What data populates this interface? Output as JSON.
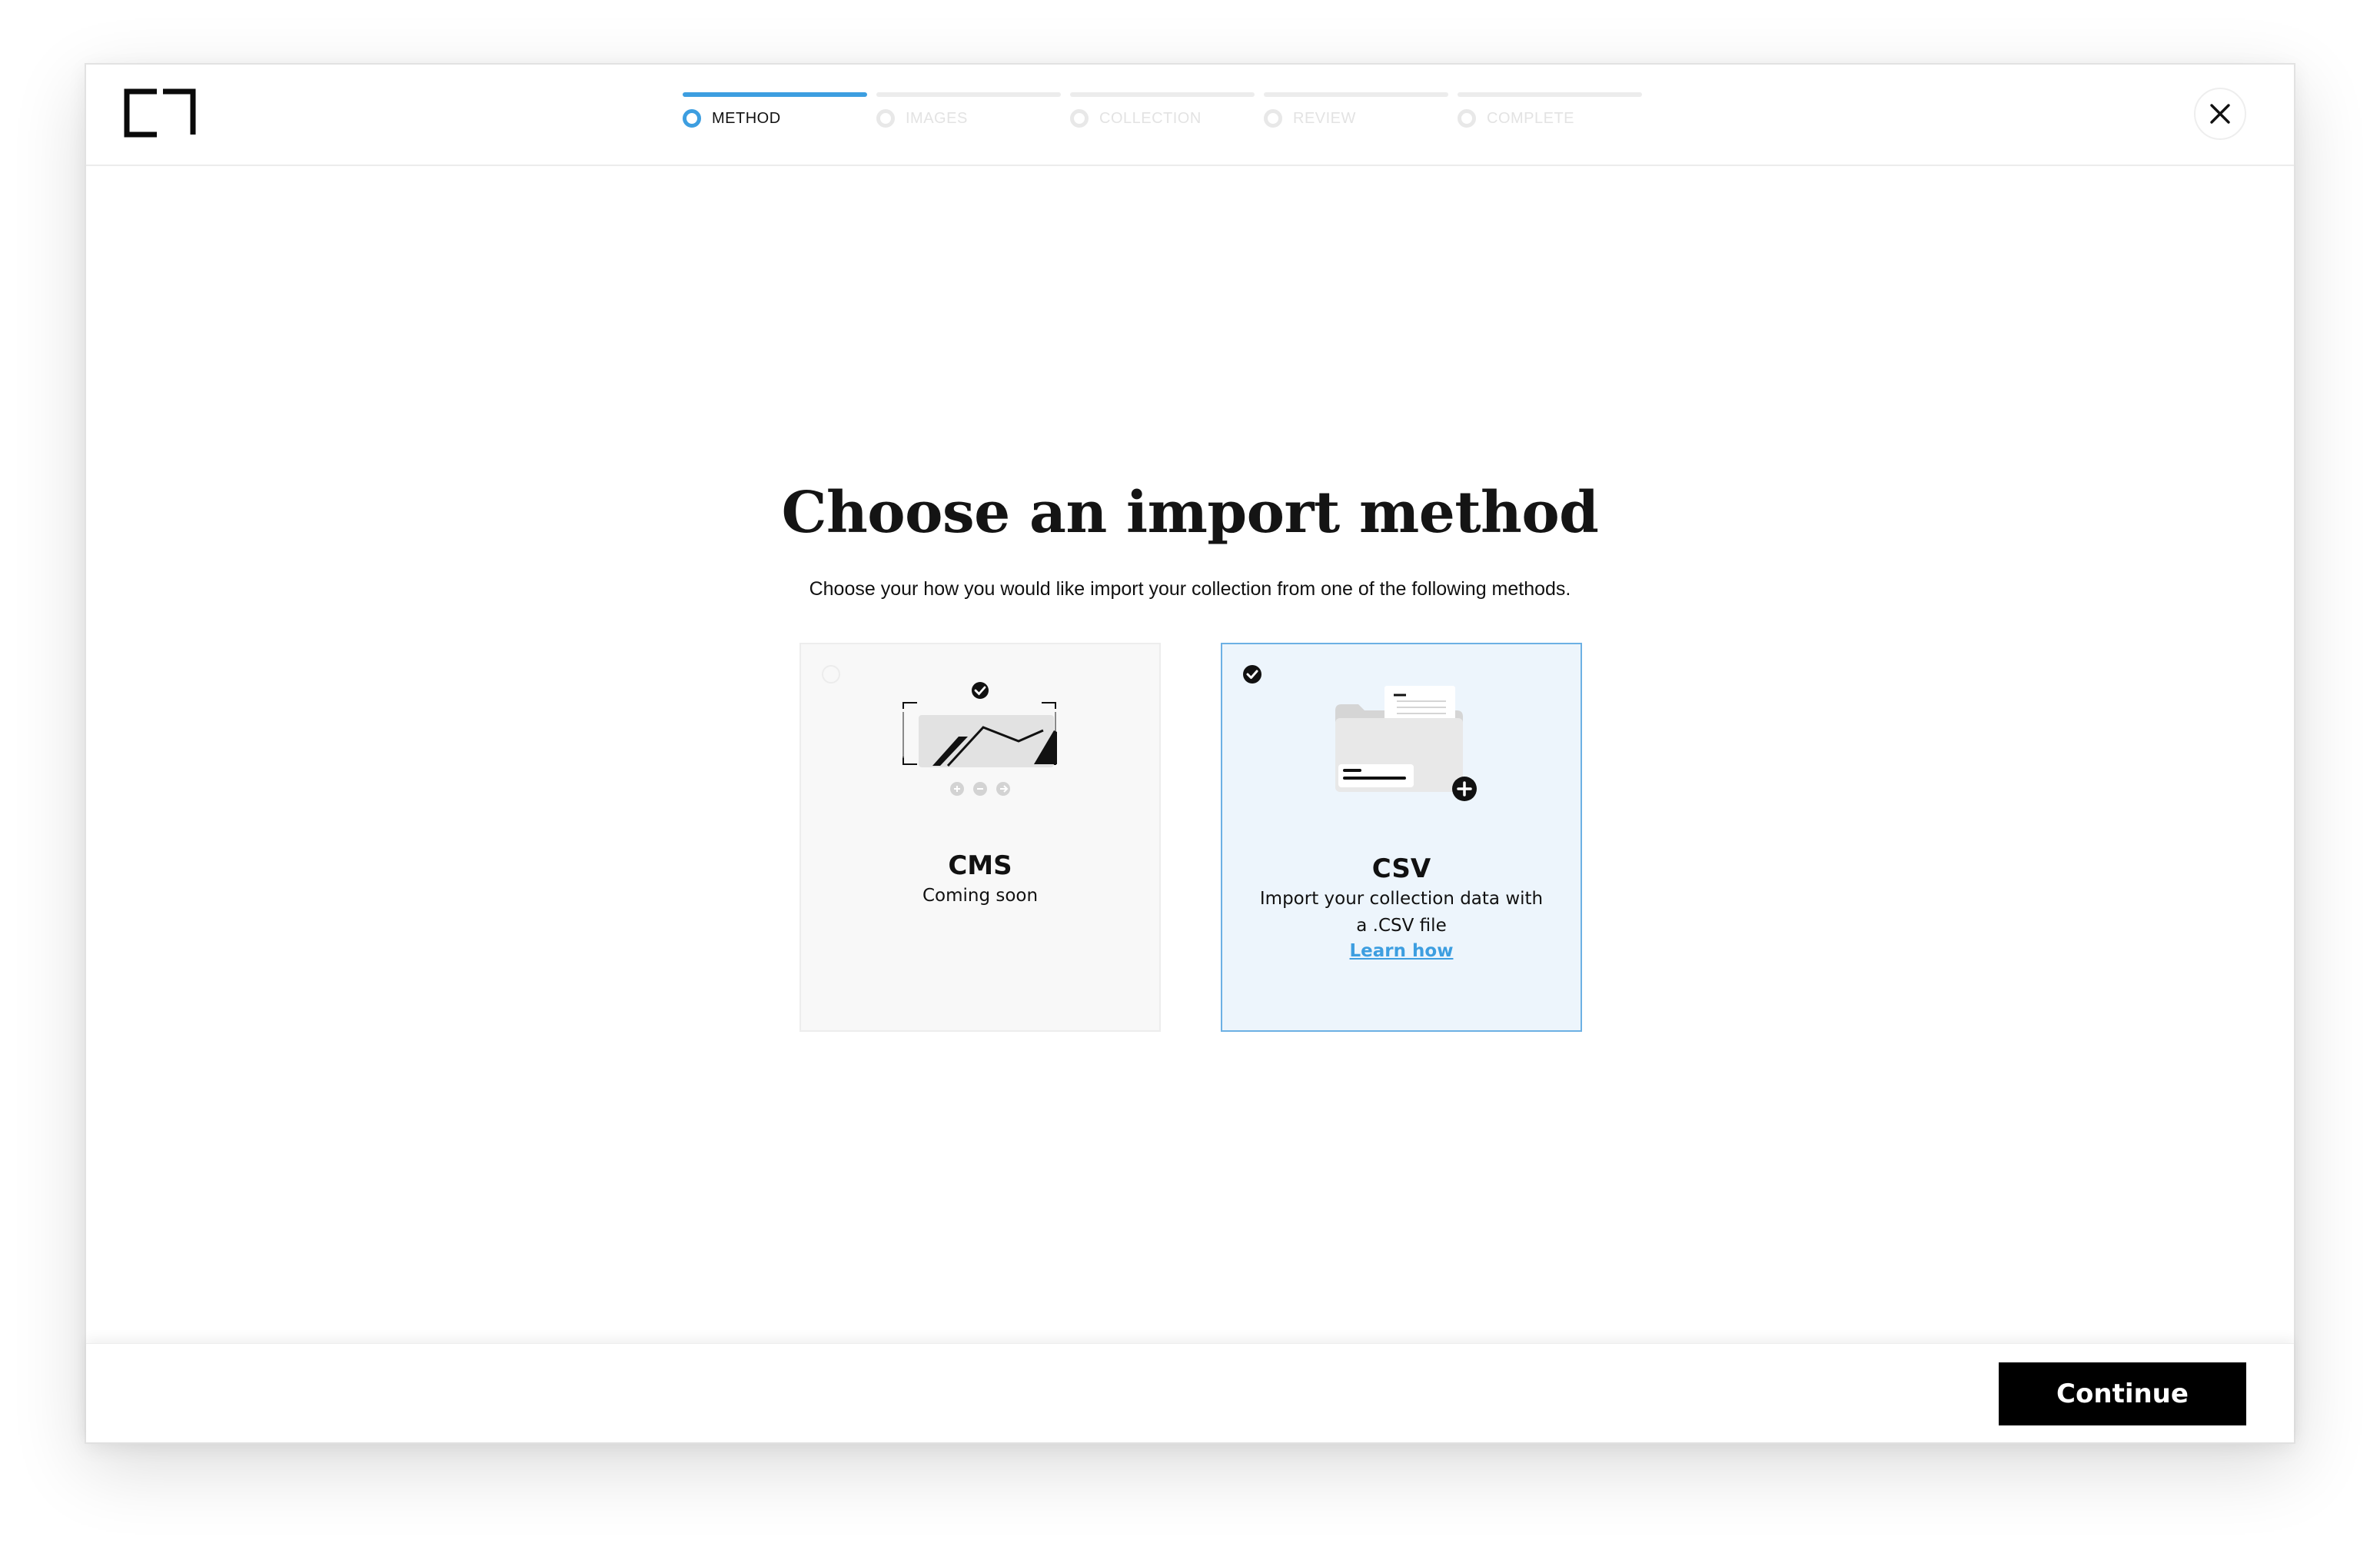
{
  "header": {
    "logo_icon": "bracket-logo-icon",
    "steps": [
      {
        "label": "METHOD",
        "active": true
      },
      {
        "label": "IMAGES",
        "active": false
      },
      {
        "label": "COLLECTION",
        "active": false
      },
      {
        "label": "REVIEW",
        "active": false
      },
      {
        "label": "COMPLETE",
        "active": false
      }
    ],
    "close_icon": "close-icon"
  },
  "main": {
    "title": "Choose an import method",
    "subtitle": "Choose your how you would like import your collection from one of the following methods.",
    "options": [
      {
        "name": "CMS",
        "description": "Coming soon",
        "selected": false,
        "disabled": true,
        "icon": "cms-illustration-icon"
      },
      {
        "name": "CSV",
        "description": "Import your collection data with a .CSV file",
        "link": "Learn how",
        "selected": true,
        "disabled": false,
        "icon": "csv-folder-illustration-icon"
      }
    ]
  },
  "footer": {
    "continue_label": "Continue"
  },
  "colors": {
    "accent": "#3d9ee0",
    "selected_bg": "#edf5fc",
    "primary_button": "#000000"
  }
}
